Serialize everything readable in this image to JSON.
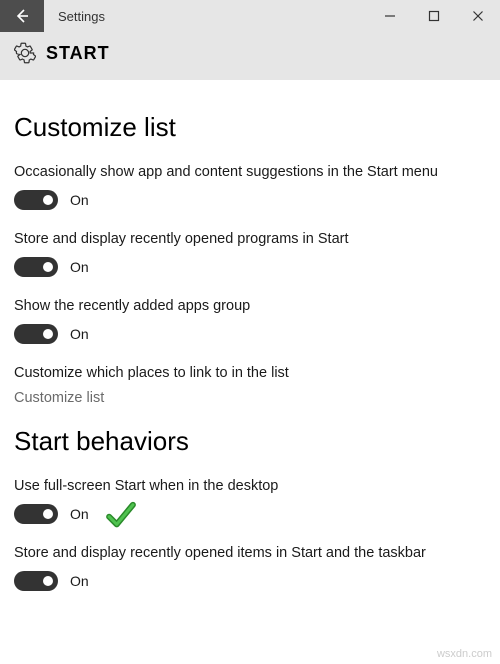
{
  "titlebar": {
    "title": "Settings"
  },
  "header": {
    "title": "START"
  },
  "sections": {
    "customize": {
      "heading": "Customize list",
      "items": [
        {
          "label": "Occasionally show app and content suggestions in the Start menu",
          "state": "On"
        },
        {
          "label": "Store and display recently opened programs in Start",
          "state": "On"
        },
        {
          "label": "Show the recently added apps group",
          "state": "On"
        }
      ],
      "linkRow": {
        "label": "Customize which places to link to in the list",
        "link": "Customize list"
      }
    },
    "behaviors": {
      "heading": "Start behaviors",
      "items": [
        {
          "label": "Use full-screen Start when in the desktop",
          "state": "On"
        },
        {
          "label": "Store and display recently opened items in Start and the taskbar",
          "state": "On"
        }
      ]
    }
  },
  "watermark": "wsxdn.com"
}
